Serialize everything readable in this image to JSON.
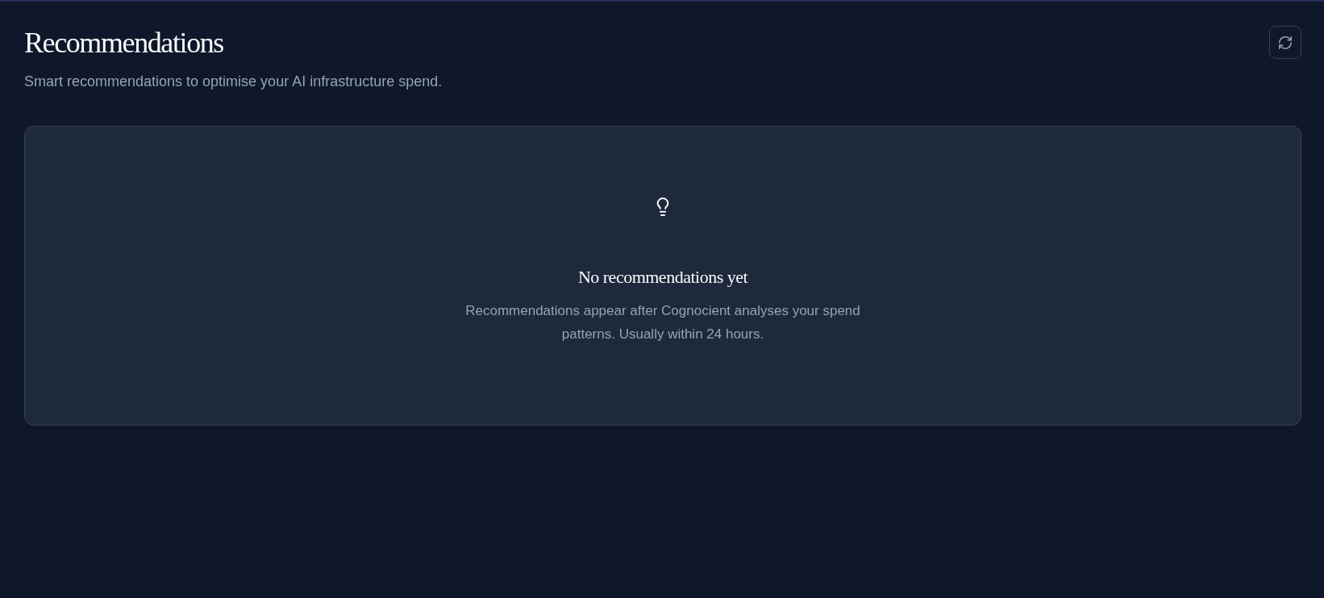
{
  "header": {
    "title": "Recommendations",
    "subtitle": "Smart recommendations to optimise your AI infrastructure spend."
  },
  "empty_state": {
    "title": "No recommendations yet",
    "description": "Recommendations appear after Cognocient analyses your spend patterns. Usually within 24 hours."
  }
}
